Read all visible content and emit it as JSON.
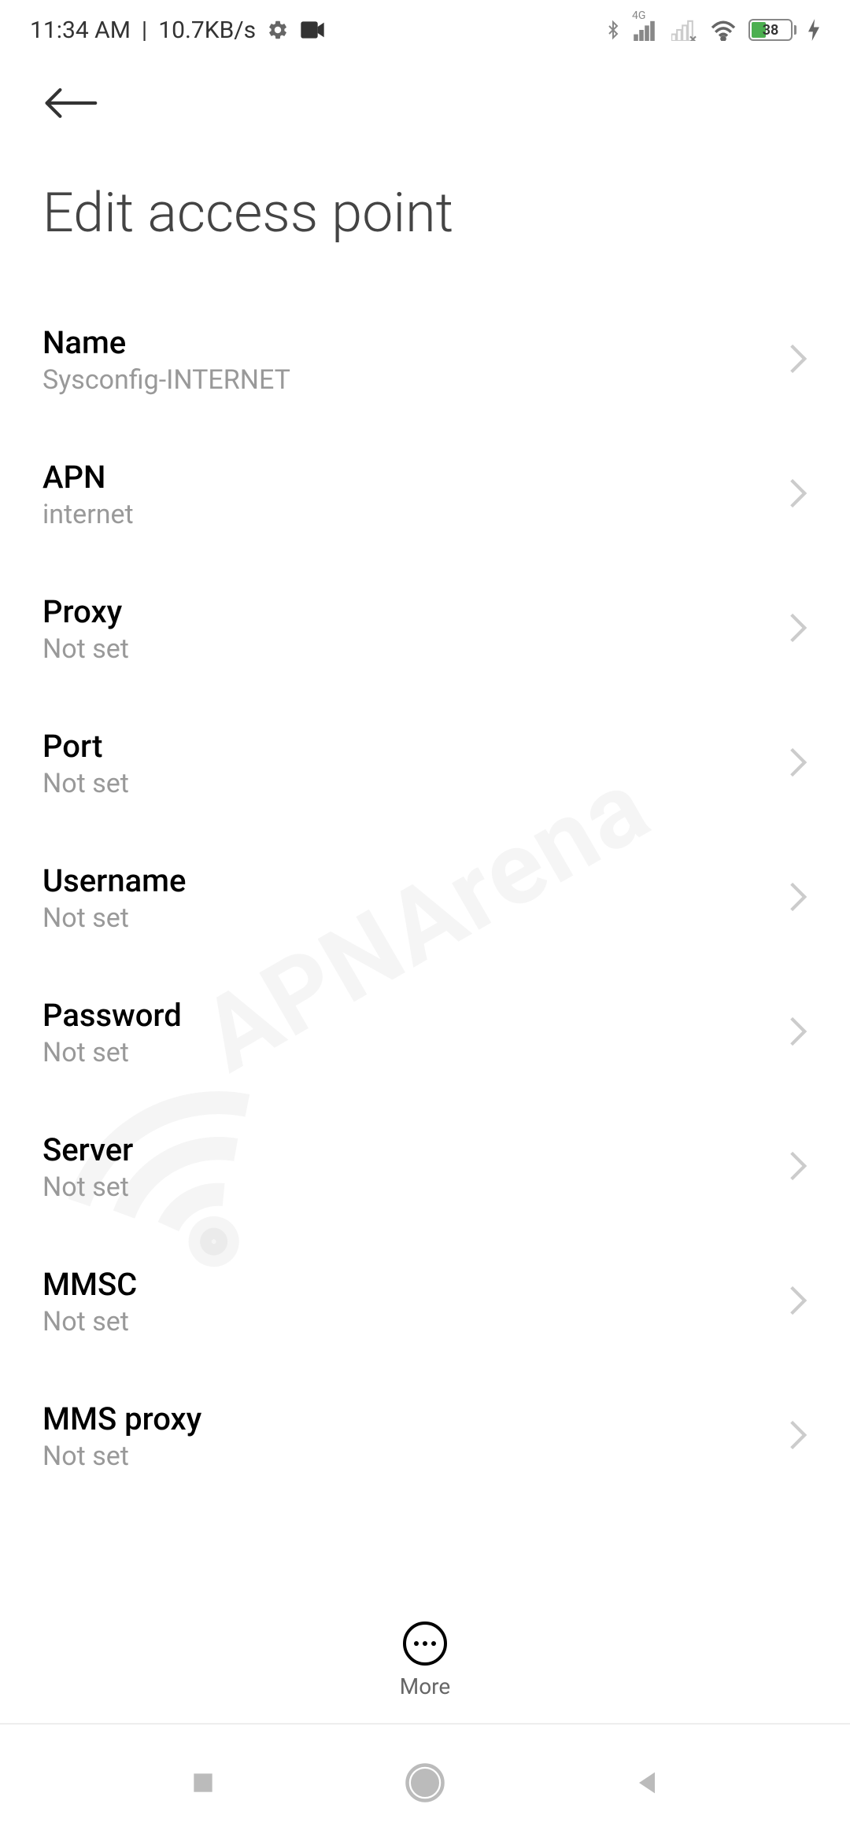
{
  "status": {
    "time": "11:34 AM",
    "separator": "|",
    "data_rate": "10.7KB/s",
    "network_type": "4G",
    "battery_level": "38"
  },
  "page": {
    "title": "Edit access point"
  },
  "settings": [
    {
      "label": "Name",
      "value": "Sysconfig-INTERNET"
    },
    {
      "label": "APN",
      "value": "internet"
    },
    {
      "label": "Proxy",
      "value": "Not set"
    },
    {
      "label": "Port",
      "value": "Not set"
    },
    {
      "label": "Username",
      "value": "Not set"
    },
    {
      "label": "Password",
      "value": "Not set"
    },
    {
      "label": "Server",
      "value": "Not set"
    },
    {
      "label": "MMSC",
      "value": "Not set"
    },
    {
      "label": "MMS proxy",
      "value": "Not set"
    }
  ],
  "bottom": {
    "more_label": "More"
  },
  "watermark": {
    "text": "APNArena"
  }
}
